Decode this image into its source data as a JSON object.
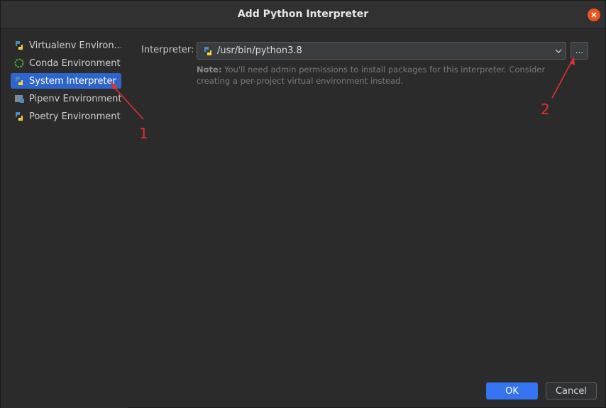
{
  "dialog": {
    "title": "Add Python Interpreter"
  },
  "sidebar": {
    "items": [
      {
        "label": "Virtualenv Environ...",
        "icon": "python-venv-icon"
      },
      {
        "label": "Conda Environment",
        "icon": "conda-icon"
      },
      {
        "label": "System Interpreter",
        "icon": "python-icon",
        "selected": true
      },
      {
        "label": "Pipenv Environment",
        "icon": "pipenv-icon"
      },
      {
        "label": "Poetry Environment",
        "icon": "poetry-icon"
      }
    ]
  },
  "main": {
    "interpreter_label": "Interpreter:",
    "interpreter_value": "/usr/bin/python3.8",
    "browse_label": "...",
    "note_prefix": "Note:",
    "note_text": "You'll need admin permissions to install packages for this interpreter. Consider creating a per-project virtual environment instead."
  },
  "footer": {
    "ok_label": "OK",
    "cancel_label": "Cancel"
  },
  "annotations": {
    "marker_1": "1",
    "marker_2": "2"
  },
  "colors": {
    "accent": "#3574f0",
    "selection": "#2f65ca",
    "close": "#e95420",
    "annotation": "#e03030"
  }
}
